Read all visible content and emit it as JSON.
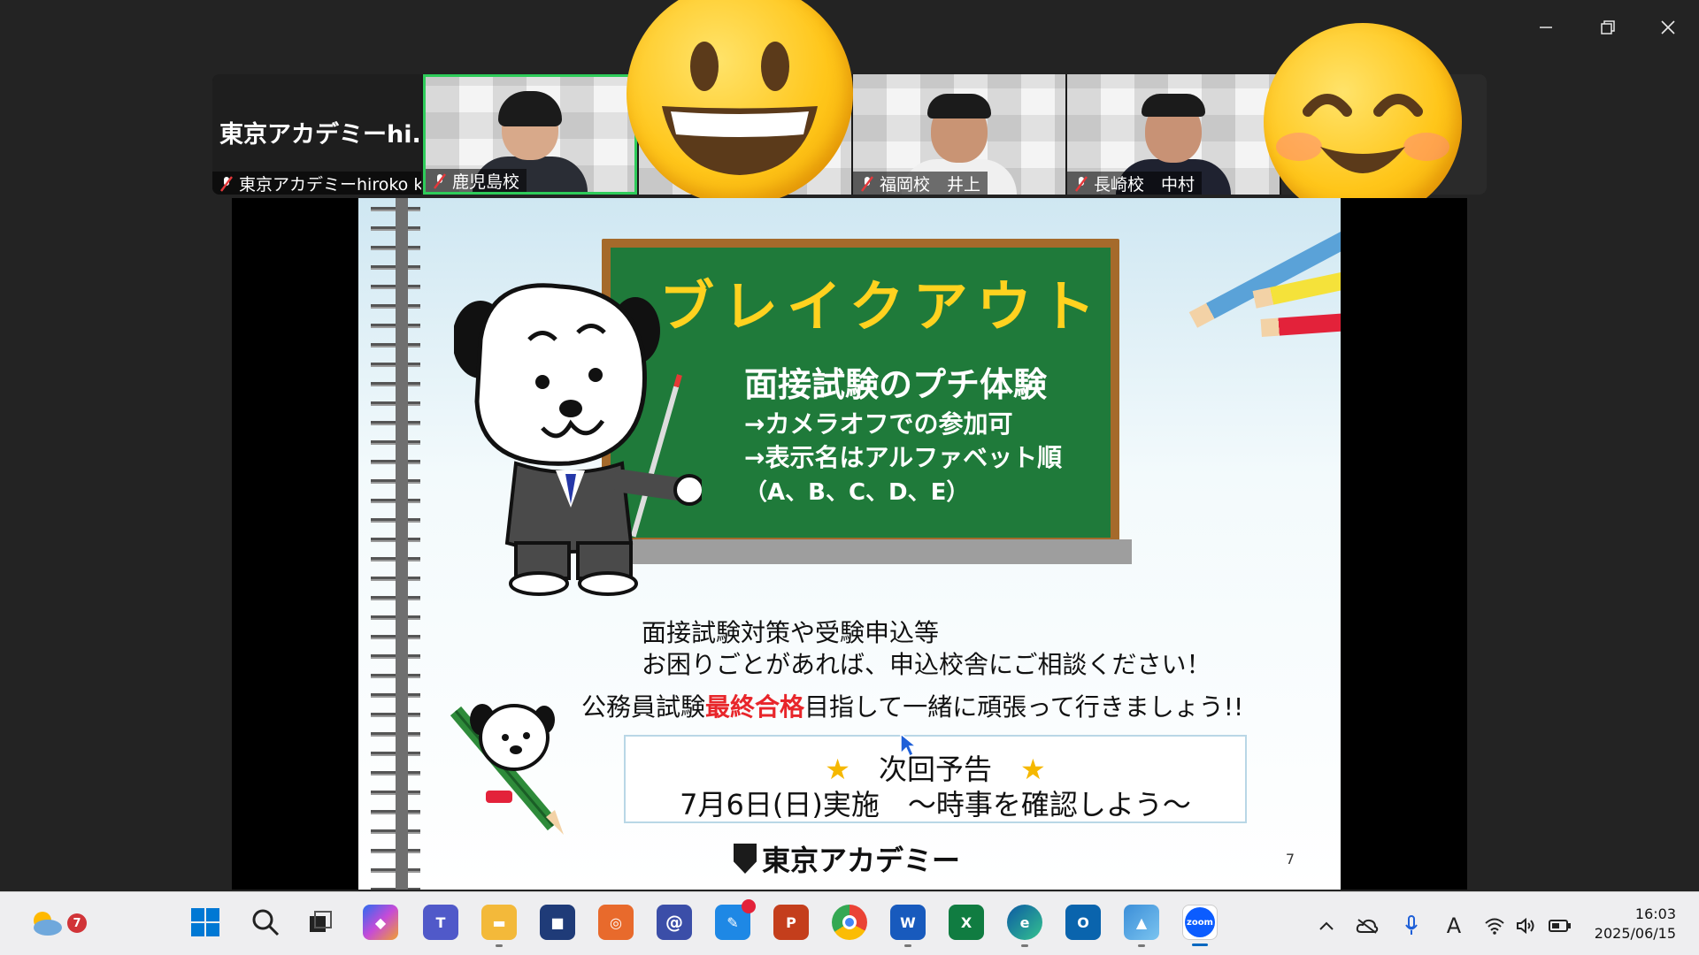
{
  "participants": [
    {
      "display_name": "東京アカデミーhi...",
      "label": "東京アカデミーhiroko ki..."
    },
    {
      "label": "鹿児島校"
    },
    {
      "label": "福岡校　井上"
    },
    {
      "label": "長崎校　中村"
    }
  ],
  "slide": {
    "title": "ブレイクアウト",
    "heading": "面接試験のプチ体験",
    "lines": [
      "→カメラオフでの参加可",
      "→表示名はアルファベット順",
      "（A、B、C、D、E）"
    ],
    "body1": "面接試験対策や受験申込等",
    "body2": "お困りごとがあれば、申込校舎にご相談ください！",
    "body3_pre": "公務員試験",
    "body3_red": "最終合格",
    "body3_post": "目指して一緒に頑張って行きましょう!!",
    "notice_title": "次回予告",
    "notice_star": "★",
    "notice_detail": "7月6日(日)実施　～時事を確認しよう～",
    "logo_text": "東京アカデミー",
    "page_number": "7"
  },
  "taskbar": {
    "weather_badge": "7",
    "clock_time": "16:03",
    "clock_date": "2025/06/15",
    "ime_indicator": "A",
    "icons": [
      "start-icon",
      "search-icon",
      "task-view-icon",
      "copilot-icon",
      "teams-icon",
      "file-explorer-icon",
      "store-icon",
      "app-icon",
      "mail-menu-icon",
      "notes-icon",
      "powerpoint-icon",
      "chrome-icon",
      "word-icon",
      "excel-icon",
      "edge-icon",
      "outlook-icon",
      "photos-icon",
      "zoom-icon"
    ],
    "icon_labels": {
      "zoom": "zoom",
      "word": "W",
      "excel": "X",
      "outlook": "O",
      "powerpoint": "P",
      "menu": "@"
    }
  },
  "colors": {
    "chalkboard": "#1f7a3a",
    "chalk_title": "#ffd21f",
    "highlight_red": "#e8262b",
    "active_speaker_border": "#2ecc5a",
    "taskbar_bg": "#eeeef0"
  }
}
